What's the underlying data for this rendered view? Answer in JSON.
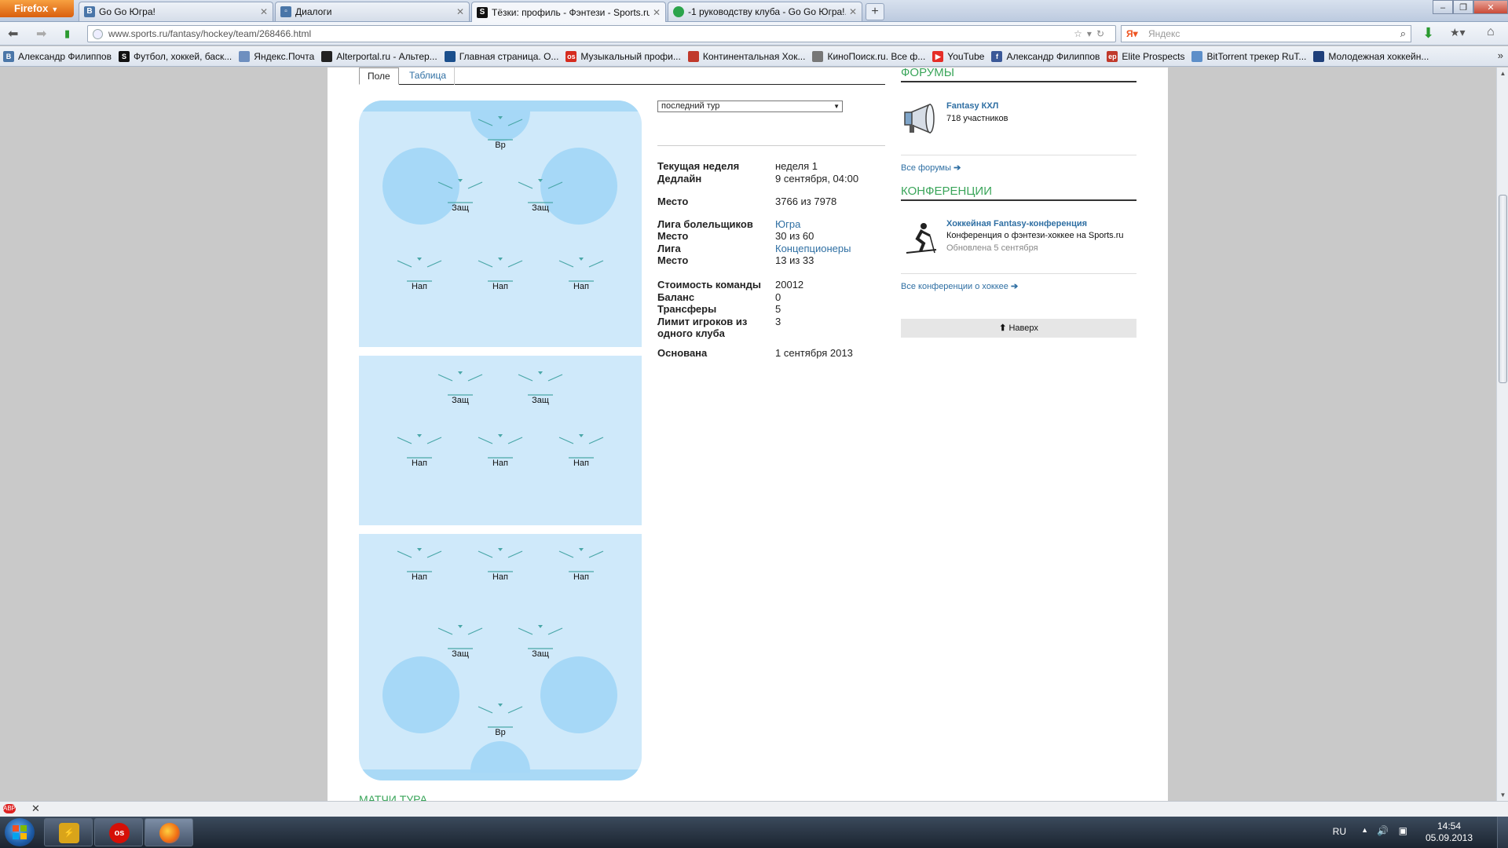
{
  "browser": {
    "menu_label": "Firefox",
    "tabs": [
      {
        "title": "Go Go Югра!",
        "favicon": "B",
        "color": "#4a76a8"
      },
      {
        "title": "Диалоги",
        "favicon": "",
        "color": "#4a76a8"
      },
      {
        "title": "Тёзки: профиль - Фэнтези - Sports.ru",
        "favicon": "S",
        "color": "#111"
      },
      {
        "title": "-1 руководству клуба - Go Go Югра!...",
        "favicon": "",
        "color": "#2ba44b"
      }
    ],
    "url": "www.sports.ru/fantasy/hockey/team/268466.html",
    "search_placeholder": "Яндекс",
    "bookmarks": [
      {
        "label": "Александр Филиппов",
        "icon": "B",
        "color": "#4a76a8"
      },
      {
        "label": "Футбол, хоккей, баск...",
        "icon": "S",
        "color": "#111"
      },
      {
        "label": "Яндекс.Почта",
        "icon": "",
        "color": "#6e8fbf"
      },
      {
        "label": "Alterportal.ru - Альтер...",
        "icon": "",
        "color": "#222"
      },
      {
        "label": "Главная страница. О...",
        "icon": "",
        "color": "#1b4f8c"
      },
      {
        "label": "Музыкальный профи...",
        "icon": "os",
        "color": "#d52b1e"
      },
      {
        "label": "Континентальная Хок...",
        "icon": "",
        "color": "#c0392b"
      },
      {
        "label": "КиноПоиск.ru. Все ф...",
        "icon": "",
        "color": "#777"
      },
      {
        "label": "YouTube",
        "icon": "▶",
        "color": "#e52d27"
      },
      {
        "label": "Александр Филиппов",
        "icon": "f",
        "color": "#3b5998"
      },
      {
        "label": "Elite Prospects",
        "icon": "ep",
        "color": "#c0392b"
      },
      {
        "label": "BitTorrent трекер RuT...",
        "icon": "",
        "color": "#5d8fc9"
      },
      {
        "label": "Молодежная хоккейн...",
        "icon": "",
        "color": "#1f3f7a"
      }
    ]
  },
  "page": {
    "field_tabs": {
      "field": "Поле",
      "table": "Таблица"
    },
    "positions": {
      "goalie": "Вр",
      "defense": "Защ",
      "forward": "Нап"
    },
    "round_select": "последний тур",
    "team_info": [
      {
        "label": "Текущая неделя",
        "value": "неделя 1",
        "link": false
      },
      {
        "label": "Дедлайн",
        "value": "9 сентября, 04:00",
        "link": false
      },
      {
        "label": "Место",
        "value": "3766 из 7978",
        "link": false
      },
      {
        "label": "Лига болельщиков",
        "value": "Югра",
        "link": true
      },
      {
        "label": "Место",
        "value": "30 из 60",
        "link": false
      },
      {
        "label": "Лига",
        "value": "Концепционеры",
        "link": true
      },
      {
        "label": "Место",
        "value": "13 из 33",
        "link": false
      },
      {
        "label": "Стоимость команды",
        "value": "20012",
        "link": false
      },
      {
        "label": "Баланс",
        "value": "0",
        "link": false
      },
      {
        "label": "Трансферы",
        "value": "5",
        "link": false
      },
      {
        "label": "Лимит игроков из одного клуба",
        "value": "3",
        "link": false
      },
      {
        "label": "Основана",
        "value": "1 сентября 2013",
        "link": false
      }
    ],
    "forums": {
      "heading": "ФОРУМЫ",
      "item_title": "Fantasy КХЛ",
      "item_members": "718 участников",
      "all_link": "Все форумы"
    },
    "conferences": {
      "heading": "КОНФЕРЕНЦИИ",
      "item_title": "Хоккейная Fantasy-конференция",
      "item_desc": "Конференция о фэнтези-хоккее на Sports.ru",
      "item_updated": "Обновлена 5 сентября",
      "all_link": "Все конференции о хоккее"
    },
    "up_button": "Наверх",
    "matches_heading": "МАТЧИ ТУРА"
  },
  "taskbar": {
    "lang": "RU",
    "time": "14:54",
    "date": "05.09.2013",
    "apps": [
      "winamp-icon",
      "lastfm-icon",
      "firefox-icon"
    ]
  },
  "colors": {
    "rink": "#cfe9fa",
    "rink_marks": "#a6d8f7",
    "slot_marks": "#4aa7a8",
    "accent_green": "#3aa55a",
    "link_blue": "#2f6fa3"
  }
}
